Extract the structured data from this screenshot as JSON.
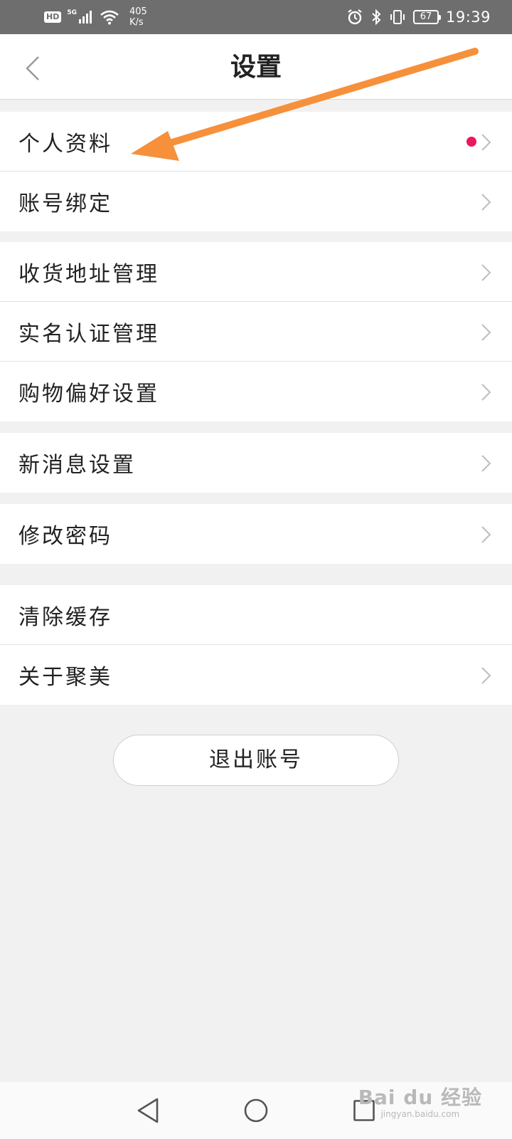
{
  "status_bar": {
    "hd": "HD",
    "network": "5G",
    "speed_value": "405",
    "speed_unit": "K/s",
    "battery": "67",
    "time": "19:39",
    "icons": [
      "signal-icon",
      "wifi-icon",
      "alarm-icon",
      "bluetooth-icon",
      "vibrate-icon",
      "battery-icon"
    ]
  },
  "header": {
    "title": "设置",
    "back_icon": "chevron-left-icon"
  },
  "groups": [
    {
      "items": [
        {
          "label": "个人资料",
          "badge": true,
          "badge_color": "#e8195f"
        },
        {
          "label": "账号绑定"
        }
      ]
    },
    {
      "items": [
        {
          "label": "收货地址管理"
        },
        {
          "label": "实名认证管理"
        },
        {
          "label": "购物偏好设置"
        }
      ]
    },
    {
      "items": [
        {
          "label": "新消息设置"
        }
      ]
    },
    {
      "items": [
        {
          "label": "修改密码"
        }
      ]
    },
    {
      "items": [
        {
          "label": "清除缓存"
        },
        {
          "label": "关于聚美"
        }
      ]
    }
  ],
  "logout_label": "退出账号",
  "nav_bar": {
    "icons": [
      "back-triangle-icon",
      "home-circle-icon",
      "recents-square-icon"
    ]
  },
  "annotation": {
    "color": "#f7903a"
  },
  "watermark": {
    "main": "Bai du 经验",
    "sub": "jingyan.baidu.com"
  },
  "colors": {
    "background": "#f1f1f1",
    "accent_badge": "#e8195f",
    "status_bar": "#6e6e6e"
  }
}
